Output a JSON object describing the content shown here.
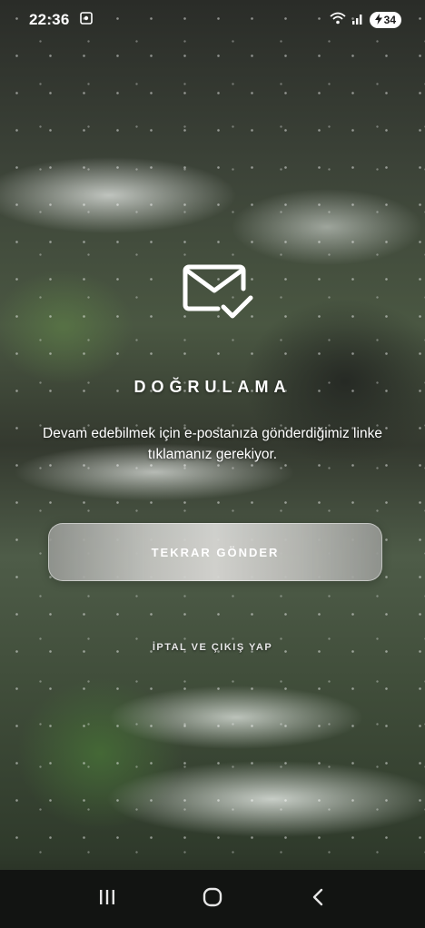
{
  "status_bar": {
    "time": "22:36",
    "battery": "34",
    "icons": [
      "screenshot-icon",
      "wifi-icon",
      "signal-icon",
      "battery-charging-icon"
    ]
  },
  "verification": {
    "icon": "mail-check-icon",
    "title": "DOĞRULAMA",
    "description": "Devam edebilmek için e-postanıza gönderdiğimiz linke tıklamanız gerekiyor.",
    "resend_button": "TEKRAR GÖNDER",
    "cancel_logout_link": "İPTAL VE ÇIKIŞ YAP"
  },
  "nav_bar": {
    "buttons": [
      "recent-apps-icon",
      "home-icon",
      "back-icon"
    ]
  },
  "colors": {
    "text": "#ffffff",
    "nav_background": "#121412"
  }
}
